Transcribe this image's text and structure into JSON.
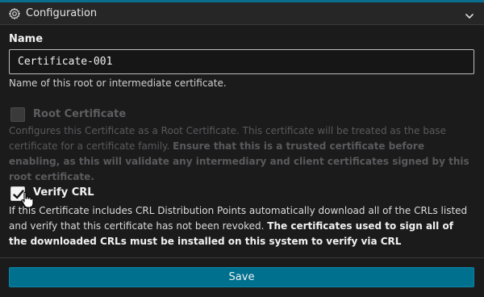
{
  "header": {
    "title": "Configuration",
    "gear_icon": "gear-icon",
    "chevron_icon": "chevron-down-icon"
  },
  "name_field": {
    "label": "Name",
    "value": "Certificate-001",
    "help": "Name of this root or intermediate certificate."
  },
  "root_certificate": {
    "label": "Root Certificate",
    "checked": false,
    "disabled": true,
    "help_plain": "Configures this Certificate as a Root Certificate. This certificate will be treated as the base certificate for a certificate family. ",
    "help_bold": "Ensure that this is a trusted certificate before enabling, as this will validate any intermediary and client certificates signed by this root certificate."
  },
  "verify_crl": {
    "label": "Verify CRL",
    "checked": true,
    "help_plain": "If this Certificate includes CRL Distribution Points automatically download all of the CRLs listed and verify that this certificate has not been revoked. ",
    "help_bold": "The certificates used to sign all of the downloaded CRLs must be installed on this system to verify via CRL"
  },
  "actions": {
    "save_label": "Save"
  },
  "colors": {
    "accent": "#00708f",
    "background": "#1b1b1c",
    "header": "#262627"
  }
}
